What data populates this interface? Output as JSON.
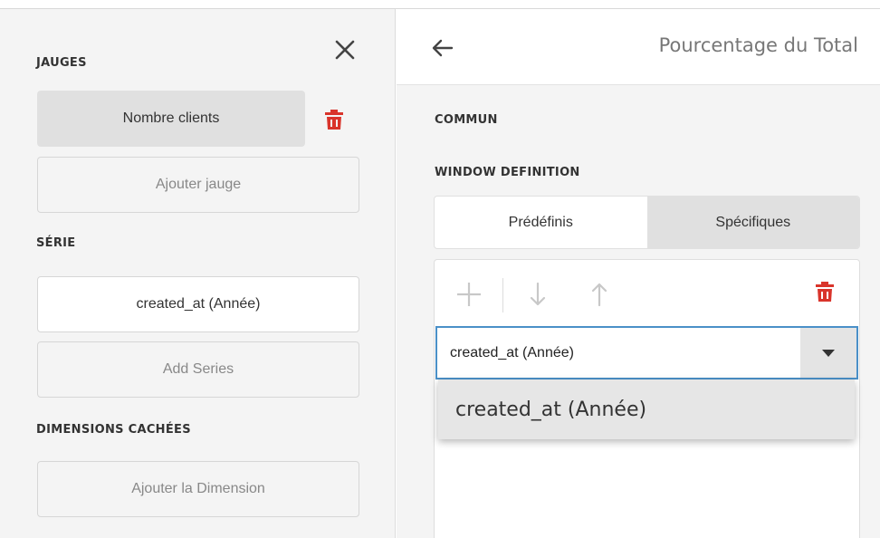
{
  "left": {
    "jauges_title": "JAUGES",
    "jauge_item": "Nombre clients",
    "add_jauge": "Ajouter jauge",
    "serie_title": "SÉRIE",
    "serie_item": "created_at (Année)",
    "add_series": "Add Series",
    "dimensions_title": "DIMENSIONS CACHÉES",
    "add_dimension": "Ajouter la Dimension"
  },
  "right": {
    "header_title": "Pourcentage du Total",
    "commun_title": "COMMUN",
    "window_title": "WINDOW DEFINITION",
    "toggle_predefined": "Prédéfinis",
    "toggle_specific": "Spécifiques",
    "select_value": "created_at (Année)",
    "dropdown_option": "created_at (Année)"
  },
  "icons": {
    "close": "close-icon",
    "trash": "trash-icon",
    "back": "arrow-left-icon",
    "add": "plus-icon",
    "down": "arrow-down-icon",
    "up": "arrow-up-icon",
    "caret": "caret-down-icon"
  },
  "colors": {
    "trash_red": "#d9342b",
    "focus_blue": "#4a90c8"
  }
}
